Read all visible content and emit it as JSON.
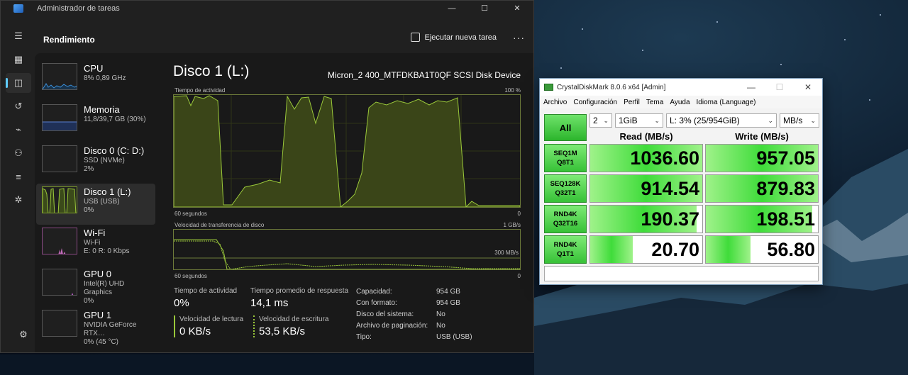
{
  "task_manager": {
    "window_title": "Administrador de tareas",
    "section_title": "Rendimiento",
    "run_task_label": "Ejecutar nueva tarea",
    "more_label": "···",
    "window_controls": [
      "—",
      "☐",
      "✕"
    ],
    "rail_icons": [
      "menu-icon",
      "processes-icon",
      "performance-icon",
      "history-icon",
      "startup-icon",
      "users-icon",
      "details-icon",
      "services-icon",
      "settings-icon"
    ],
    "perf_items": [
      {
        "name": "CPU",
        "line1": "8% 0,89 GHz",
        "line2": "",
        "color": "#3b8ed6"
      },
      {
        "name": "Memoria",
        "line1": "11,8/39,7 GB (30%)",
        "line2": "",
        "color": "#5a7fd0"
      },
      {
        "name": "Disco 0 (C: D:)",
        "line1": "SSD (NVMe)",
        "line2": "2%",
        "color": "#7ac142"
      },
      {
        "name": "Disco 1 (L:)",
        "line1": "USB (USB)",
        "line2": "0%",
        "color": "#9ac83a"
      },
      {
        "name": "Wi-Fi",
        "line1": "Wi-Fi",
        "line2": "E: 0 R: 0 Kbps",
        "color": "#c06ab8"
      },
      {
        "name": "GPU 0",
        "line1": "Intel(R) UHD Graphics",
        "line2": "0%",
        "color": "#b05ac0"
      },
      {
        "name": "GPU 1",
        "line1": "NVIDIA GeForce RTX…",
        "line2": "0% (45 °C)",
        "color": "#b05ac0"
      }
    ],
    "detail": {
      "title": "Disco 1 (L:)",
      "device": "Micron_2 400_MTFDKBA1T0QF SCSI Disk Device",
      "graph1_label": "Tiempo de actividad",
      "graph1_max": "100 %",
      "graph1_xlabel": "60 segundos",
      "graph1_min": "0",
      "graph2_label": "Velocidad de transferencia de disco",
      "graph2_max": "1 GB/s",
      "graph2_mid": "300 MB/s",
      "graph2_xlabel": "60 segundos",
      "graph2_min": "0",
      "active_time_label": "Tiempo de actividad",
      "active_time_value": "0%",
      "resp_time_label": "Tiempo promedio de respuesta",
      "resp_time_value": "14,1 ms",
      "read_speed_label": "Velocidad de lectura",
      "read_speed_value": "0 KB/s",
      "write_speed_label": "Velocidad de escritura",
      "write_speed_value": "53,5 KB/s",
      "props": [
        {
          "k": "Capacidad:",
          "v": "954 GB"
        },
        {
          "k": "Con formato:",
          "v": "954 GB"
        },
        {
          "k": "Disco del sistema:",
          "v": "No"
        },
        {
          "k": "Archivo de paginación:",
          "v": "No"
        },
        {
          "k": "Tipo:",
          "v": "USB (USB)"
        }
      ]
    }
  },
  "cdm": {
    "window_title": "CrystalDiskMark 8.0.6 x64 [Admin]",
    "window_controls": [
      "—",
      "☐",
      "✕"
    ],
    "menu": [
      "Archivo",
      "Configuración",
      "Perfil",
      "Tema",
      "Ayuda",
      "Idioma (Language)"
    ],
    "count": "2",
    "size": "1GiB",
    "drive": "L: 3% (25/954GiB)",
    "unit": "MB/s",
    "all_label": "All",
    "read_header": "Read (MB/s)",
    "write_header": "Write (MB/s)",
    "rows": [
      {
        "l1": "SEQ1M",
        "l2": "Q8T1",
        "read": "1036.60",
        "write": "957.05",
        "read_fill": 1.0,
        "write_fill": 1.0
      },
      {
        "l1": "SEQ128K",
        "l2": "Q32T1",
        "read": "914.54",
        "write": "879.83",
        "read_fill": 1.0,
        "write_fill": 1.0
      },
      {
        "l1": "RND4K",
        "l2": "Q32T16",
        "read": "190.37",
        "write": "198.51",
        "read_fill": 0.95,
        "write_fill": 0.95
      },
      {
        "l1": "RND4K",
        "l2": "Q1T1",
        "read": "20.70",
        "write": "56.80",
        "read_fill": 0.38,
        "write_fill": 0.4
      }
    ],
    "comment": ""
  }
}
